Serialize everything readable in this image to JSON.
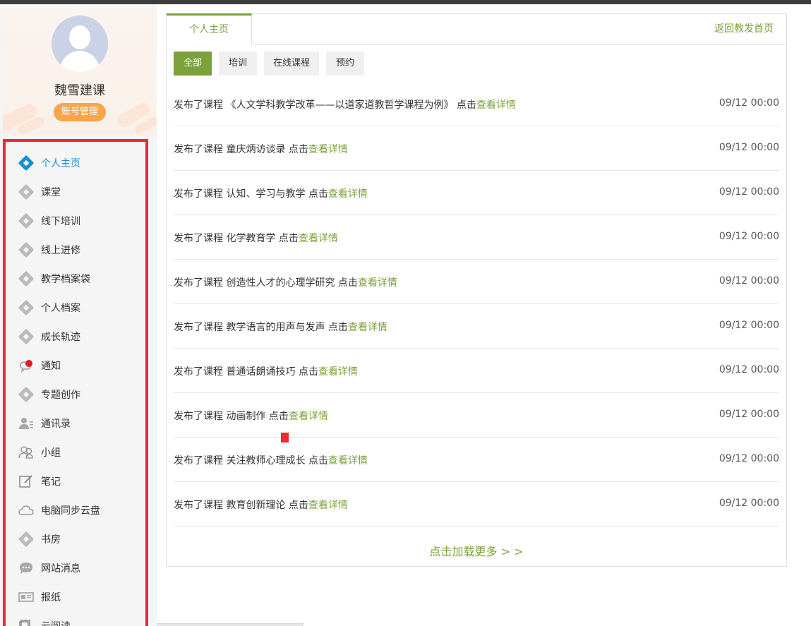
{
  "profile": {
    "username": "魏雪建课",
    "account_button": "账号管理"
  },
  "sidebar": {
    "items": [
      {
        "label": "个人主页",
        "icon": "cube-icon",
        "active": true
      },
      {
        "label": "课堂",
        "icon": "cube-icon"
      },
      {
        "label": "线下培训",
        "icon": "cube-icon"
      },
      {
        "label": "线上进修",
        "icon": "cube-icon"
      },
      {
        "label": "教学档案袋",
        "icon": "cube-icon"
      },
      {
        "label": "个人档案",
        "icon": "cube-icon"
      },
      {
        "label": "成长轨迹",
        "icon": "cube-icon"
      },
      {
        "label": "通知",
        "icon": "notification-bell-icon"
      },
      {
        "label": "专题创作",
        "icon": "cube-icon"
      },
      {
        "label": "通讯录",
        "icon": "contacts-icon"
      },
      {
        "label": "小组",
        "icon": "group-icon"
      },
      {
        "label": "笔记",
        "icon": "note-edit-icon"
      },
      {
        "label": "电脑同步云盘",
        "icon": "cloud-icon"
      },
      {
        "label": "书房",
        "icon": "cube-icon"
      },
      {
        "label": "网站消息",
        "icon": "chat-bubble-icon"
      },
      {
        "label": "报纸",
        "icon": "newspaper-icon"
      },
      {
        "label": "云阅读",
        "icon": "book-icon"
      }
    ]
  },
  "main": {
    "tab_home": "个人主页",
    "back_link": "返回教发首页",
    "filters": [
      "全部",
      "培训",
      "在线课程",
      "预约"
    ],
    "active_filter": "全部",
    "feed": [
      {
        "prefix": "发布了课程 《人文学科教学改革——以道家道教哲学课程为例》 点击",
        "link": "查看详情",
        "time": "09/12 00:00"
      },
      {
        "prefix": "发布了课程 童庆炳访谈录 点击",
        "link": "查看详情",
        "time": "09/12 00:00"
      },
      {
        "prefix": "发布了课程 认知、学习与教学 点击",
        "link": "查看详情",
        "time": "09/12 00:00"
      },
      {
        "prefix": "发布了课程 化学教育学 点击",
        "link": "查看详情",
        "time": "09/12 00:00"
      },
      {
        "prefix": "发布了课程 创造性人才的心理学研究 点击",
        "link": "查看详情",
        "time": "09/12 00:00"
      },
      {
        "prefix": "发布了课程 教学语言的用声与发声 点击",
        "link": "查看详情",
        "time": "09/12 00:00"
      },
      {
        "prefix": "发布了课程 普通话朗诵技巧 点击",
        "link": "查看详情",
        "time": "09/12 00:00"
      },
      {
        "prefix": "发布了课程 动画制作 点击",
        "link": "查看详情",
        "time": "09/12 00:00"
      },
      {
        "prefix": "发布了课程 关注教师心理成长 点击",
        "link": "查看详情",
        "time": "09/12 00:00"
      },
      {
        "prefix": "发布了课程 教育创新理论 点击",
        "link": "查看详情",
        "time": "09/12 00:00"
      }
    ],
    "load_more": "点击加载更多 > >"
  },
  "colors": {
    "accent_green": "#7aa23a",
    "active_blue": "#1a8fd6",
    "highlight_red": "#ee2b2f",
    "account_orange": "#f7a64a"
  }
}
